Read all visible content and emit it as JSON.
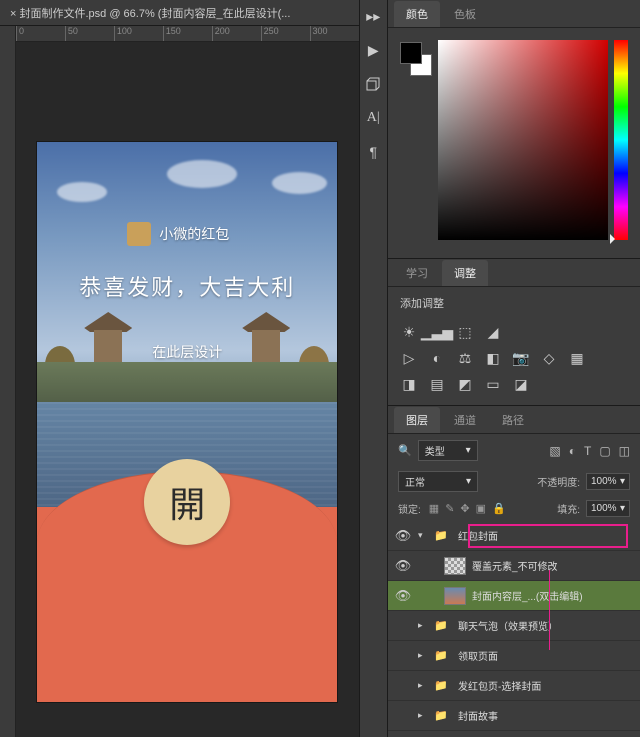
{
  "tab": {
    "title": "× 封面制作文件.psd @ 66.7% (封面内容层_在此层设计(...",
    "close": "×"
  },
  "ruler": [
    "0",
    "50",
    "100",
    "150",
    "200",
    "250",
    "300"
  ],
  "artboard": {
    "red_packet_owner": "小微的红包",
    "greeting": "恭喜发财，大吉大利",
    "design_hint": "在此层设计",
    "open_label": "開"
  },
  "color_tabs": {
    "color": "颜色",
    "swatches": "色板"
  },
  "adjust_tabs": {
    "learn": "学习",
    "adjust": "调整"
  },
  "adjust_header": "添加调整",
  "layers_tabs": {
    "layers": "图层",
    "channels": "通道",
    "paths": "路径"
  },
  "layer_filter": {
    "label": "类型"
  },
  "blend": {
    "mode": "正常",
    "opacity_label": "不透明度:",
    "opacity": "100%"
  },
  "lock": {
    "label": "锁定:",
    "fill_label": "填充:",
    "fill": "100%"
  },
  "layers": [
    {
      "eye": true,
      "expanded": true,
      "type": "folder",
      "indent": 0,
      "name": "红包封面",
      "highlighted": true
    },
    {
      "eye": true,
      "type": "layer",
      "indent": 1,
      "thumb": "checker",
      "name": "覆盖元素_不可修改"
    },
    {
      "eye": true,
      "type": "layer",
      "indent": 1,
      "thumb": "image",
      "name": "封面内容层_...(双击编辑)",
      "selected": true
    },
    {
      "eye": false,
      "expanded": false,
      "type": "folder",
      "indent": 0,
      "name": "聊天气泡（效果预览）"
    },
    {
      "eye": false,
      "expanded": false,
      "type": "folder",
      "indent": 0,
      "name": "领取页面"
    },
    {
      "eye": false,
      "expanded": false,
      "type": "folder",
      "indent": 0,
      "name": "发红包页-选择封面"
    },
    {
      "eye": false,
      "expanded": false,
      "type": "folder",
      "indent": 0,
      "name": "封面故事"
    }
  ]
}
